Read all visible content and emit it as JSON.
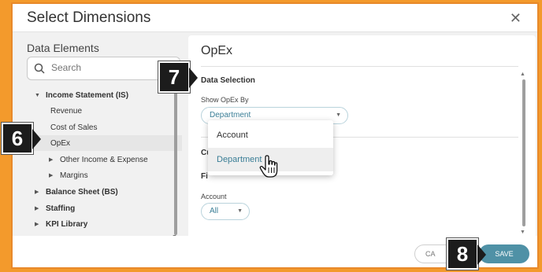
{
  "dialog": {
    "title": "Select Dimensions",
    "close_icon": "close-icon"
  },
  "left": {
    "title": "Data Elements",
    "search_placeholder": "Search",
    "tree": [
      {
        "label": "Income Statement (IS)",
        "expanded": true,
        "bold": true
      },
      {
        "label": "Revenue"
      },
      {
        "label": "Cost of Sales"
      },
      {
        "label": "OpEx",
        "selected": true
      },
      {
        "label": "Other Income & Expense",
        "expandable": true
      },
      {
        "label": "Margins",
        "expandable": true
      },
      {
        "label": "Balance Sheet (BS)",
        "bold": true,
        "expandable": true
      },
      {
        "label": "Staffing",
        "bold": true,
        "expandable": true
      },
      {
        "label": "KPI Library",
        "bold": true,
        "expandable": true
      }
    ]
  },
  "right": {
    "title": "OpEx",
    "section_data_selection": "Data Selection",
    "show_by_label": "Show OpEx By",
    "show_by_value": "Department",
    "section_cu": "Cu",
    "section_fi": "Fi",
    "account_label": "Account",
    "account_value": "All"
  },
  "dropdown": {
    "options": [
      "Account",
      "Department"
    ],
    "hovered": "Department"
  },
  "footer": {
    "cancel_label": "CA",
    "save_label": "SAVE"
  },
  "badges": [
    "6",
    "7",
    "8"
  ],
  "colors": {
    "accent": "#4f91a6",
    "frame": "#f39a2c",
    "link": "#3a7e96"
  }
}
